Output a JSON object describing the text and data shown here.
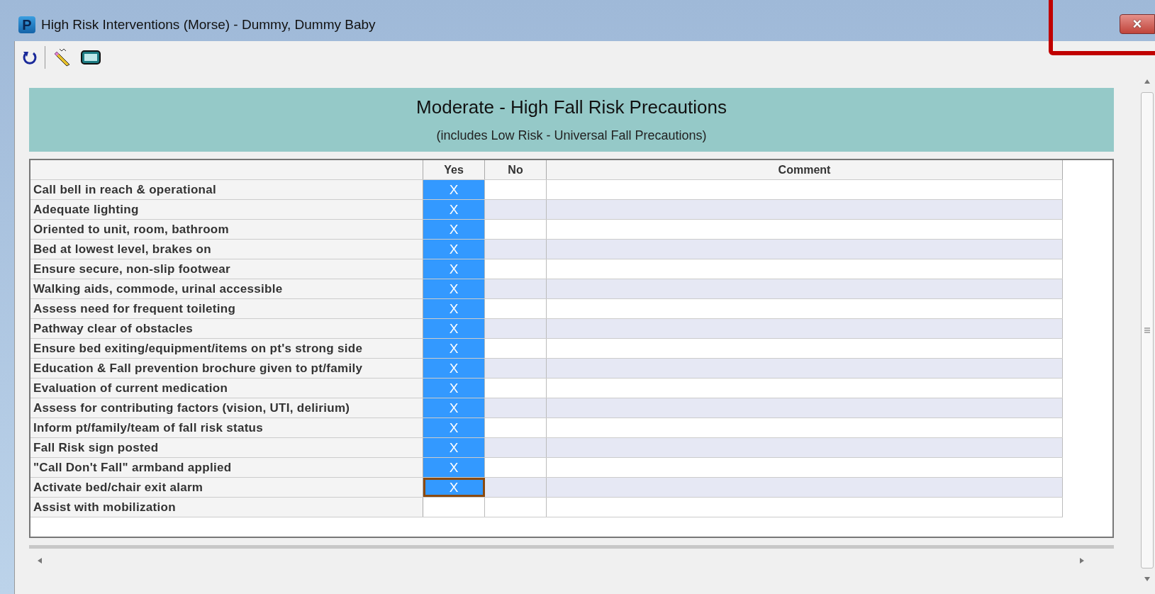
{
  "window": {
    "title": "High Risk Interventions (Morse) - Dummy, Dummy Baby",
    "app_letter": "P",
    "close": "×"
  },
  "header": {
    "title": "Moderate - High Fall Risk Precautions",
    "subtitle": "(includes Low Risk - Universal Fall Precautions)"
  },
  "table": {
    "columns": [
      "Yes",
      "No",
      "Comment"
    ],
    "rows": [
      {
        "label": "Call bell in reach & operational",
        "yes": "X",
        "focused": false
      },
      {
        "label": "Adequate lighting",
        "yes": "X",
        "focused": false
      },
      {
        "label": "Oriented to unit, room, bathroom",
        "yes": "X",
        "focused": false
      },
      {
        "label": "Bed at lowest level, brakes on",
        "yes": "X",
        "focused": false
      },
      {
        "label": "Ensure secure, non-slip footwear",
        "yes": "X",
        "focused": false
      },
      {
        "label": "Walking aids, commode, urinal accessible",
        "yes": "X",
        "focused": false
      },
      {
        "label": "Assess need for frequent toileting",
        "yes": "X",
        "focused": false
      },
      {
        "label": "Pathway clear of obstacles",
        "yes": "X",
        "focused": false
      },
      {
        "label": "Ensure bed exiting/equipment/items on pt's strong side",
        "yes": "X",
        "focused": false
      },
      {
        "label": "Education & Fall prevention brochure given to pt/family",
        "yes": "X",
        "focused": false
      },
      {
        "label": "Evaluation of current medication",
        "yes": "X",
        "focused": false
      },
      {
        "label": "Assess for contributing factors (vision, UTI, delirium)",
        "yes": "X",
        "focused": false
      },
      {
        "label": "Inform pt/family/team of fall risk status",
        "yes": "X",
        "focused": false
      },
      {
        "label": "Fall Risk sign posted",
        "yes": "X",
        "focused": false
      },
      {
        "label": "\"Call Don't Fall\" armband applied",
        "yes": "X",
        "focused": false
      },
      {
        "label": "Activate bed/chair exit alarm",
        "yes": "X",
        "focused": true
      },
      {
        "label": "Assist with mobilization",
        "focused": false
      }
    ]
  }
}
